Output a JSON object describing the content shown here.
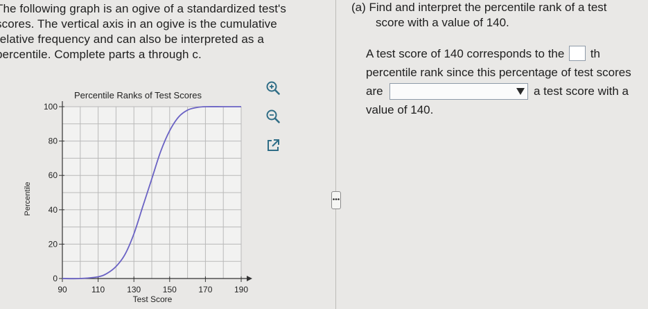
{
  "intro": {
    "lines": [
      "The following graph is an ogive of a standardized test's",
      "scores. The vertical axis in an ogive is the cumulative",
      "relative frequency and can also be interpreted as a",
      "percentile. Complete parts a through c."
    ]
  },
  "toolbar": {
    "icons": [
      "zoom-in-icon",
      "zoom-out-icon",
      "open-external-icon"
    ]
  },
  "more_button": {
    "label": "•••"
  },
  "question": {
    "line1": "(a) Find and interpret the percentile rank of a test",
    "line2": "score with a value of 140."
  },
  "answer": {
    "part1": "A test score of 140 corresponds to the",
    "th_suffix": "th",
    "line2": "percentile rank since this percentage of test scores",
    "are_label": "are",
    "after_select": "a test score with a",
    "line4": "value of 140.",
    "rank_value": "",
    "select_value": ""
  },
  "chart_data": {
    "type": "line",
    "title": "Percentile Ranks of Test Scores",
    "xlabel": "Test Score",
    "ylabel": "Percentile",
    "xlim": [
      90,
      190
    ],
    "ylim": [
      0,
      100
    ],
    "xticks": [
      90,
      110,
      130,
      150,
      170,
      190
    ],
    "yticks": [
      0,
      20,
      40,
      60,
      80,
      100
    ],
    "grid": true,
    "line_color": "#6a62c4",
    "x": [
      90,
      100,
      110,
      115,
      120,
      125,
      130,
      135,
      140,
      145,
      150,
      155,
      160,
      165,
      170,
      180,
      190
    ],
    "y": [
      0,
      0,
      1,
      3,
      7,
      14,
      26,
      42,
      58,
      74,
      86,
      94,
      98,
      99.5,
      100,
      100,
      100
    ]
  }
}
